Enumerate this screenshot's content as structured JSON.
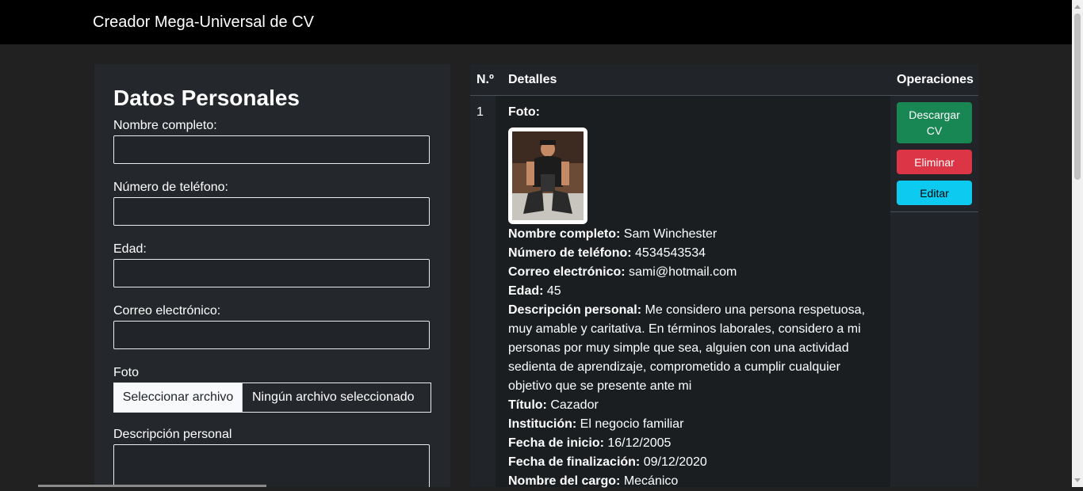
{
  "navbar": {
    "brand": "Creador Mega-Universal de CV"
  },
  "form": {
    "title": "Datos Personales",
    "fields": {
      "nombre_label": "Nombre completo:",
      "telefono_label": "Número de teléfono:",
      "edad_label": "Edad:",
      "correo_label": "Correo electrónico:",
      "foto_label": "Foto",
      "descripcion_label": "Descripción personal"
    },
    "file_button": "Seleccionar archivo",
    "file_status": "Ningún archivo seleccionado"
  },
  "table": {
    "headers": {
      "num": "N.º",
      "details": "Detalles",
      "ops": "Operaciones"
    },
    "row": {
      "num": "1",
      "foto_label": "Foto:",
      "nombre": {
        "label": "Nombre completo:",
        "value": "Sam Winchester"
      },
      "telefono": {
        "label": "Número de teléfono:",
        "value": "4534543534"
      },
      "correo": {
        "label": "Correo electrónico:",
        "value": "sami@hotmail.com"
      },
      "edad": {
        "label": "Edad:",
        "value": "45"
      },
      "descripcion": {
        "label": "Descripción personal:",
        "value": "Me considero una persona respetuosa, muy amable y caritativa. En términos laborales, considero a mi personas por muy simple que sea, alguien con una actividad sedienta de aprendizaje, comprometido a cumplir cualquier objetivo que se presente ante mi"
      },
      "titulo": {
        "label": "Título:",
        "value": "Cazador"
      },
      "institucion": {
        "label": "Institución:",
        "value": "El negocio familiar"
      },
      "inicio": {
        "label": "Fecha de inicio:",
        "value": "16/12/2005"
      },
      "fin": {
        "label": "Fecha de finalización:",
        "value": "09/12/2020"
      },
      "cargo": {
        "label": "Nombre del cargo:",
        "value": "Mecánico"
      }
    },
    "ops": {
      "download": "Descargar CV",
      "delete": "Eliminar",
      "edit": "Editar"
    }
  },
  "colors": {
    "download": "#198754",
    "delete": "#dc3545",
    "edit": "#0dcaf0"
  }
}
